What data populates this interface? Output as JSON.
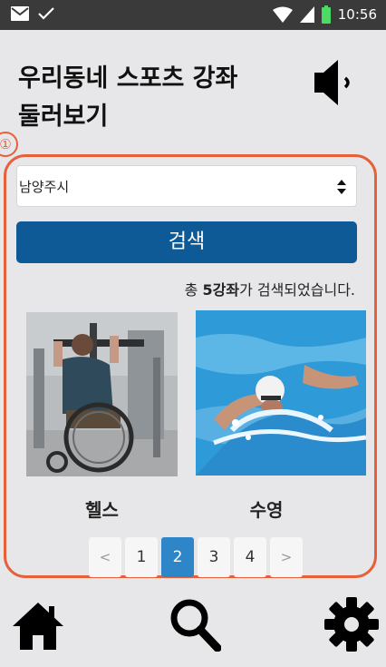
{
  "status_bar": {
    "time": "10:56"
  },
  "header": {
    "title_line1": "우리동네 스포츠 강좌",
    "title_line2": "둘러보기",
    "speaker_icon": "speaker-icon"
  },
  "annotation": {
    "marker": "①"
  },
  "filter": {
    "region_value": "남양주시",
    "search_label": "검색"
  },
  "result": {
    "prefix": "총 ",
    "count": "5강좌",
    "suffix": "가 검색되었습니다."
  },
  "cards": [
    {
      "label": "헬스"
    },
    {
      "label": "수영"
    }
  ],
  "pagination": {
    "prev": "<",
    "pages": [
      "1",
      "2",
      "3",
      "4"
    ],
    "next": ">",
    "current": "2"
  },
  "nav": {
    "home": "home-icon",
    "search": "search-icon",
    "settings": "gear-icon"
  },
  "colors": {
    "accent": "#0d5a96",
    "highlight": "#e8603a",
    "active_page": "#2e86c9",
    "status_bar": "#3a3a3a"
  }
}
